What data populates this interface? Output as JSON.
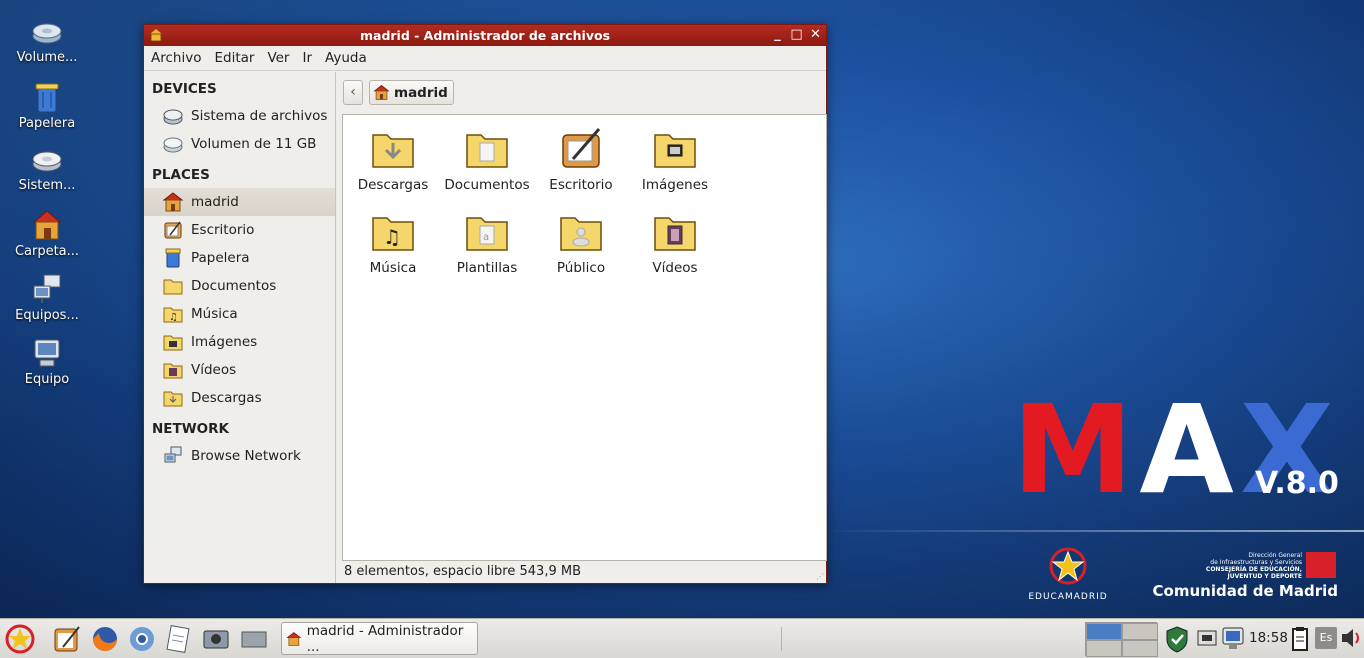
{
  "desktop": {
    "icons": [
      {
        "label": "Volume...",
        "icon": "drive-icon"
      },
      {
        "label": "Papelera",
        "icon": "trash-icon"
      },
      {
        "label": "Sistem...",
        "icon": "drive-icon"
      },
      {
        "label": "Carpeta...",
        "icon": "home-folder-icon"
      },
      {
        "label": "Equipos...",
        "icon": "network-icon"
      },
      {
        "label": "Equipo",
        "icon": "computer-icon"
      }
    ],
    "brand": {
      "m": "M",
      "a": "A",
      "x": "X",
      "version": "V.8.0",
      "educa": "EDUCAMADRID",
      "cm_small_1": "Dirección General",
      "cm_small_2": "de Infraestructuras y Servicios",
      "cm_small_3": "CONSEJERÍA DE EDUCACIÓN,",
      "cm_small_4": "JUVENTUD Y DEPORTE",
      "cm_big": "Comunidad de Madrid",
      "colors": {
        "m": "#e31a22",
        "a": "#ffffff",
        "x": "#3a6ad2"
      }
    }
  },
  "window": {
    "title": "madrid - Administrador de archivos",
    "controls": {
      "minimize": "_",
      "maximize": "□",
      "close": "✕"
    },
    "menu": [
      "Archivo",
      "Editar",
      "Ver",
      "Ir",
      "Ayuda"
    ],
    "sidebar": {
      "devices_header": "DEVICES",
      "devices": [
        {
          "label": "Sistema de archivos",
          "icon": "drive-icon"
        },
        {
          "label": "Volumen de 11 GB",
          "icon": "drive-icon"
        }
      ],
      "places_header": "PLACES",
      "places": [
        {
          "label": "madrid",
          "icon": "home-folder-icon",
          "active": true
        },
        {
          "label": "Escritorio",
          "icon": "desktop-icon"
        },
        {
          "label": "Papelera",
          "icon": "trash-icon"
        },
        {
          "label": "Documentos",
          "icon": "folder-icon"
        },
        {
          "label": "Música",
          "icon": "music-folder-icon"
        },
        {
          "label": "Imágenes",
          "icon": "pictures-folder-icon"
        },
        {
          "label": "Vídeos",
          "icon": "videos-folder-icon"
        },
        {
          "label": "Descargas",
          "icon": "downloads-folder-icon"
        }
      ],
      "network_header": "NETWORK",
      "network": [
        {
          "label": "Browse Network",
          "icon": "network-icon"
        }
      ]
    },
    "location": {
      "back": "‹",
      "current": "madrid"
    },
    "files": [
      {
        "label": "Descargas",
        "icon": "downloads-folder-icon"
      },
      {
        "label": "Documentos",
        "icon": "documents-folder-icon"
      },
      {
        "label": "Escritorio",
        "icon": "desktop-icon"
      },
      {
        "label": "Imágenes",
        "icon": "pictures-folder-icon"
      },
      {
        "label": "Música",
        "icon": "music-folder-icon"
      },
      {
        "label": "Plantillas",
        "icon": "templates-folder-icon"
      },
      {
        "label": "Público",
        "icon": "public-folder-icon"
      },
      {
        "label": "Vídeos",
        "icon": "videos-folder-icon"
      }
    ],
    "status": "8 elementos, espacio libre 543,9 MB"
  },
  "taskbar": {
    "task_label": "madrid - Administrador ...",
    "clock": "18:58",
    "lang": "Es"
  }
}
